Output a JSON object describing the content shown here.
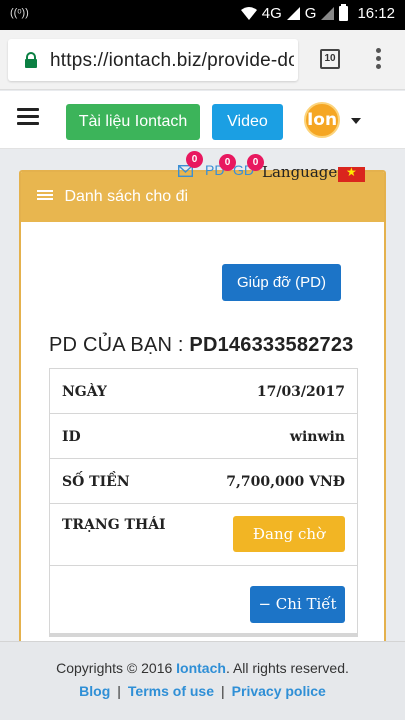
{
  "statusbar": {
    "network": "4G",
    "network2": "G",
    "time": "16:12"
  },
  "browser": {
    "url": "https://iontach.biz/provide-dor",
    "tab_count": "10"
  },
  "header": {
    "docs_button": "Tài liệu Iontach",
    "video_button": "Video",
    "logo_text": "Ion"
  },
  "notifications": {
    "mail_count": "0",
    "pd_label": "PD",
    "pd_count": "0",
    "gd_label": "GD",
    "gd_count": "0",
    "language_label": "Language:"
  },
  "card": {
    "title": "Danh sách cho đi",
    "help_button": "Giúp đỡ (PD)",
    "pd_prefix": "PD CỦA BẠN : ",
    "pd_code": "PD146333582723",
    "rows": [
      {
        "label": "NGÀY",
        "value": "17/03/2017"
      },
      {
        "label": "ID",
        "value": "winwin"
      },
      {
        "label": "SỐ TIỀN",
        "value": "7,700,000 VNĐ"
      },
      {
        "label": "TRẠNG THÁI",
        "value": "Đang chờ"
      }
    ],
    "detail_button": "− Chi Tiết"
  },
  "footer": {
    "copyright_prefix": "Copyrights © 2016 ",
    "brand": "Iontach",
    "copyright_suffix": ". All rights reserved.",
    "links": [
      "Blog",
      "Terms of use",
      "Privacy police"
    ],
    "separator": "|"
  },
  "colors": {
    "accent_green": "#3cb45a",
    "accent_blue": "#1c74c7",
    "card_header": "#e8b64f",
    "badge": "#e8185f"
  }
}
